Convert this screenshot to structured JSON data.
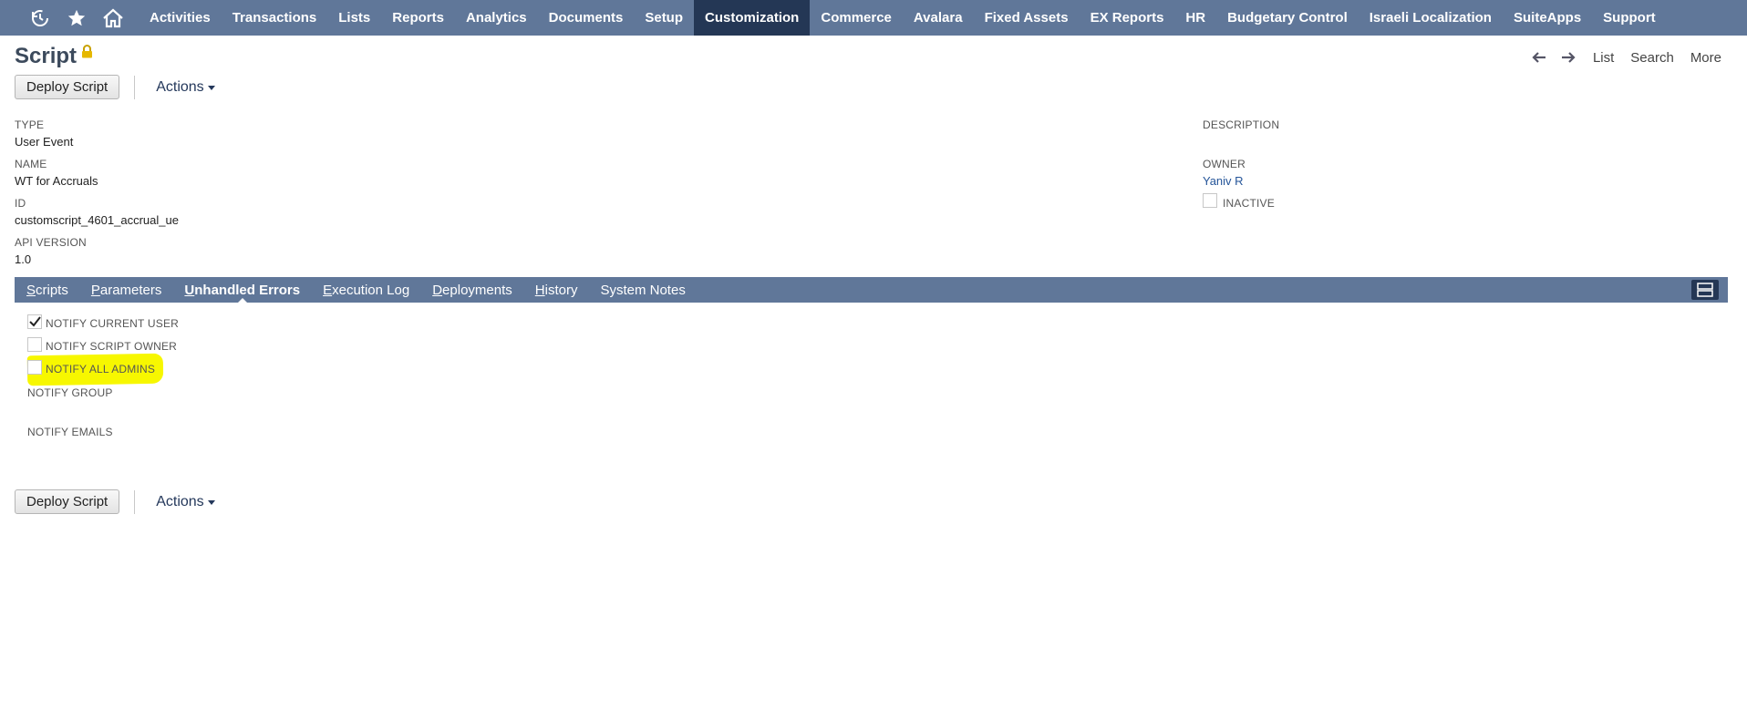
{
  "nav": {
    "icons": [
      "recent-icon",
      "star-icon",
      "home-icon"
    ],
    "items": [
      {
        "label": "Activities",
        "active": false
      },
      {
        "label": "Transactions",
        "active": false
      },
      {
        "label": "Lists",
        "active": false
      },
      {
        "label": "Reports",
        "active": false
      },
      {
        "label": "Analytics",
        "active": false
      },
      {
        "label": "Documents",
        "active": false
      },
      {
        "label": "Setup",
        "active": false
      },
      {
        "label": "Customization",
        "active": true
      },
      {
        "label": "Commerce",
        "active": false
      },
      {
        "label": "Avalara",
        "active": false
      },
      {
        "label": "Fixed Assets",
        "active": false
      },
      {
        "label": "EX Reports",
        "active": false
      },
      {
        "label": "HR",
        "active": false
      },
      {
        "label": "Budgetary Control",
        "active": false
      },
      {
        "label": "Israeli Localization",
        "active": false
      },
      {
        "label": "SuiteApps",
        "active": false
      },
      {
        "label": "Support",
        "active": false
      }
    ]
  },
  "page": {
    "title": "Script",
    "right_nav": {
      "list": "List",
      "search": "Search",
      "more": "More"
    }
  },
  "buttons": {
    "deploy": "Deploy Script",
    "actions": "Actions"
  },
  "fields": {
    "type": {
      "label": "TYPE",
      "value": "User Event"
    },
    "name": {
      "label": "NAME",
      "value": "WT for Accruals"
    },
    "id": {
      "label": "ID",
      "value": "customscript_4601_accrual_ue"
    },
    "api_version": {
      "label": "API VERSION",
      "value": "1.0"
    },
    "description": {
      "label": "DESCRIPTION",
      "value": ""
    },
    "owner": {
      "label": "OWNER",
      "value": "Yaniv R"
    },
    "inactive": {
      "label": "INACTIVE",
      "checked": false
    }
  },
  "tabs": [
    {
      "first": "S",
      "rest": "cripts",
      "active": false
    },
    {
      "first": "P",
      "rest": "arameters",
      "active": false
    },
    {
      "first": "U",
      "rest": "nhandled Errors",
      "active": true
    },
    {
      "first": "E",
      "rest": "xecution Log",
      "active": false
    },
    {
      "first": "D",
      "rest": "eployments",
      "active": false
    },
    {
      "first": "H",
      "rest": "istory",
      "active": false
    },
    {
      "first": "",
      "rest": "System Notes",
      "active": false
    }
  ],
  "notify": {
    "current_user": {
      "label": "NOTIFY CURRENT USER",
      "checked": true
    },
    "script_owner": {
      "label": "NOTIFY SCRIPT OWNER",
      "checked": false
    },
    "all_admins": {
      "label": "NOTIFY ALL ADMINS",
      "checked": false,
      "highlighted": true
    },
    "group": {
      "label": "NOTIFY GROUP"
    },
    "emails": {
      "label": "NOTIFY EMAILS"
    }
  },
  "colors": {
    "nav_bg": "#607799",
    "nav_active": "#243755",
    "highlight": "#f7f700",
    "link": "#255599"
  }
}
